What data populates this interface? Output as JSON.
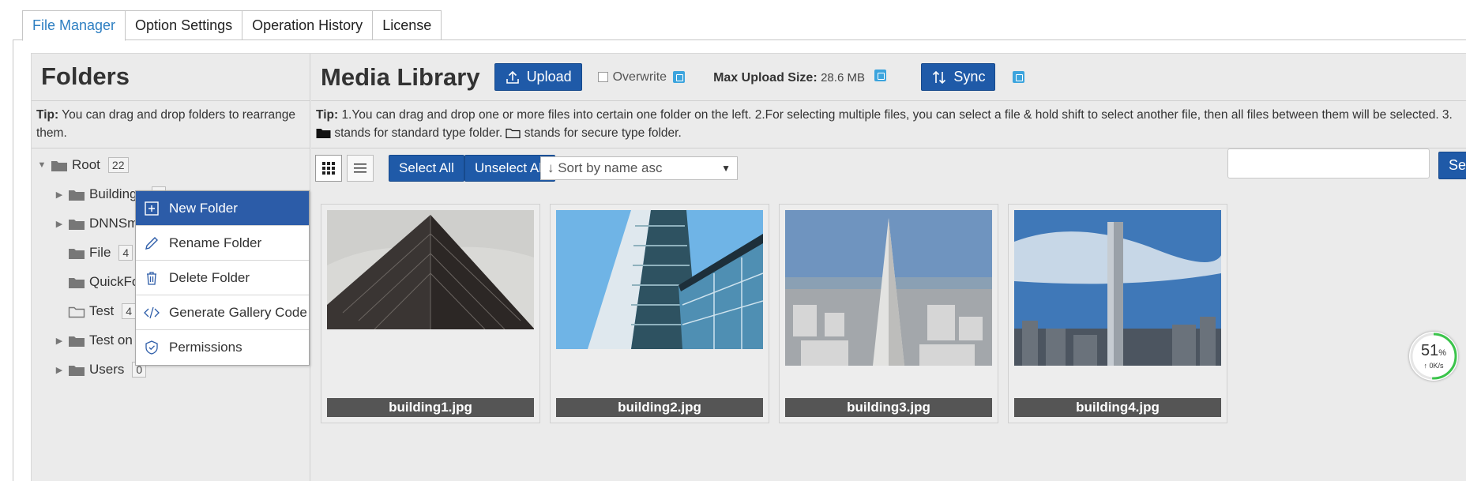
{
  "tabs": [
    {
      "label": "File Manager"
    },
    {
      "label": "Option Settings"
    },
    {
      "label": "Operation History"
    },
    {
      "label": "License"
    }
  ],
  "folders": {
    "title": "Folders",
    "tip_label": "Tip:",
    "tip_text": "You can drag and drop folders to rearrange them.",
    "tree": [
      {
        "name": "Root",
        "count": "22"
      },
      {
        "name": "Buildings",
        "count": "4"
      },
      {
        "name": "DNNSm",
        "count": ""
      },
      {
        "name": "File",
        "count": "4"
      },
      {
        "name": "QuickFo",
        "count": ""
      },
      {
        "name": "Test",
        "count": "4"
      },
      {
        "name": "Test on",
        "count": ""
      },
      {
        "name": "Users",
        "count": "0"
      }
    ]
  },
  "context_menu": {
    "items": [
      {
        "label": "New Folder",
        "icon": "plus-square-icon"
      },
      {
        "label": "Rename Folder",
        "icon": "pencil-icon"
      },
      {
        "label": "Delete Folder",
        "icon": "trash-icon"
      },
      {
        "label": "Generate Gallery Code",
        "icon": "code-icon"
      },
      {
        "label": "Permissions",
        "icon": "shield-icon"
      }
    ]
  },
  "library": {
    "title": "Media Library",
    "upload_label": "Upload",
    "overwrite_label": "Overwrite",
    "max_upload_label": "Max Upload Size:",
    "max_upload_value": "28.6 MB",
    "sync_label": "Sync",
    "tip_label": "Tip:",
    "tip_text_1": "1.You can drag and drop one or more files into certain one folder on the left. 2.For selecting multiple files, you can select a file & hold shift to select another file, then all files between them will be selected. 3.",
    "tip_text_2": "stands for standard type folder.",
    "tip_text_3": "stands for secure type folder.",
    "select_all_label": "Select All",
    "unselect_all_label": "Unselect All",
    "sort_value": "↓ Sort by name asc",
    "search_value": "",
    "search_label": "Search",
    "files": [
      {
        "name": "building1.jpg"
      },
      {
        "name": "building2.jpg"
      },
      {
        "name": "building3.jpg"
      },
      {
        "name": "building4.jpg"
      }
    ]
  },
  "speed_widget": {
    "percent": "51",
    "percent_unit": "%",
    "rate": "0K/s"
  },
  "colors": {
    "primary_button": "#1f5aa8",
    "active_tab_text": "#2e7fc2",
    "menu_highlight": "#2c5ca8"
  }
}
